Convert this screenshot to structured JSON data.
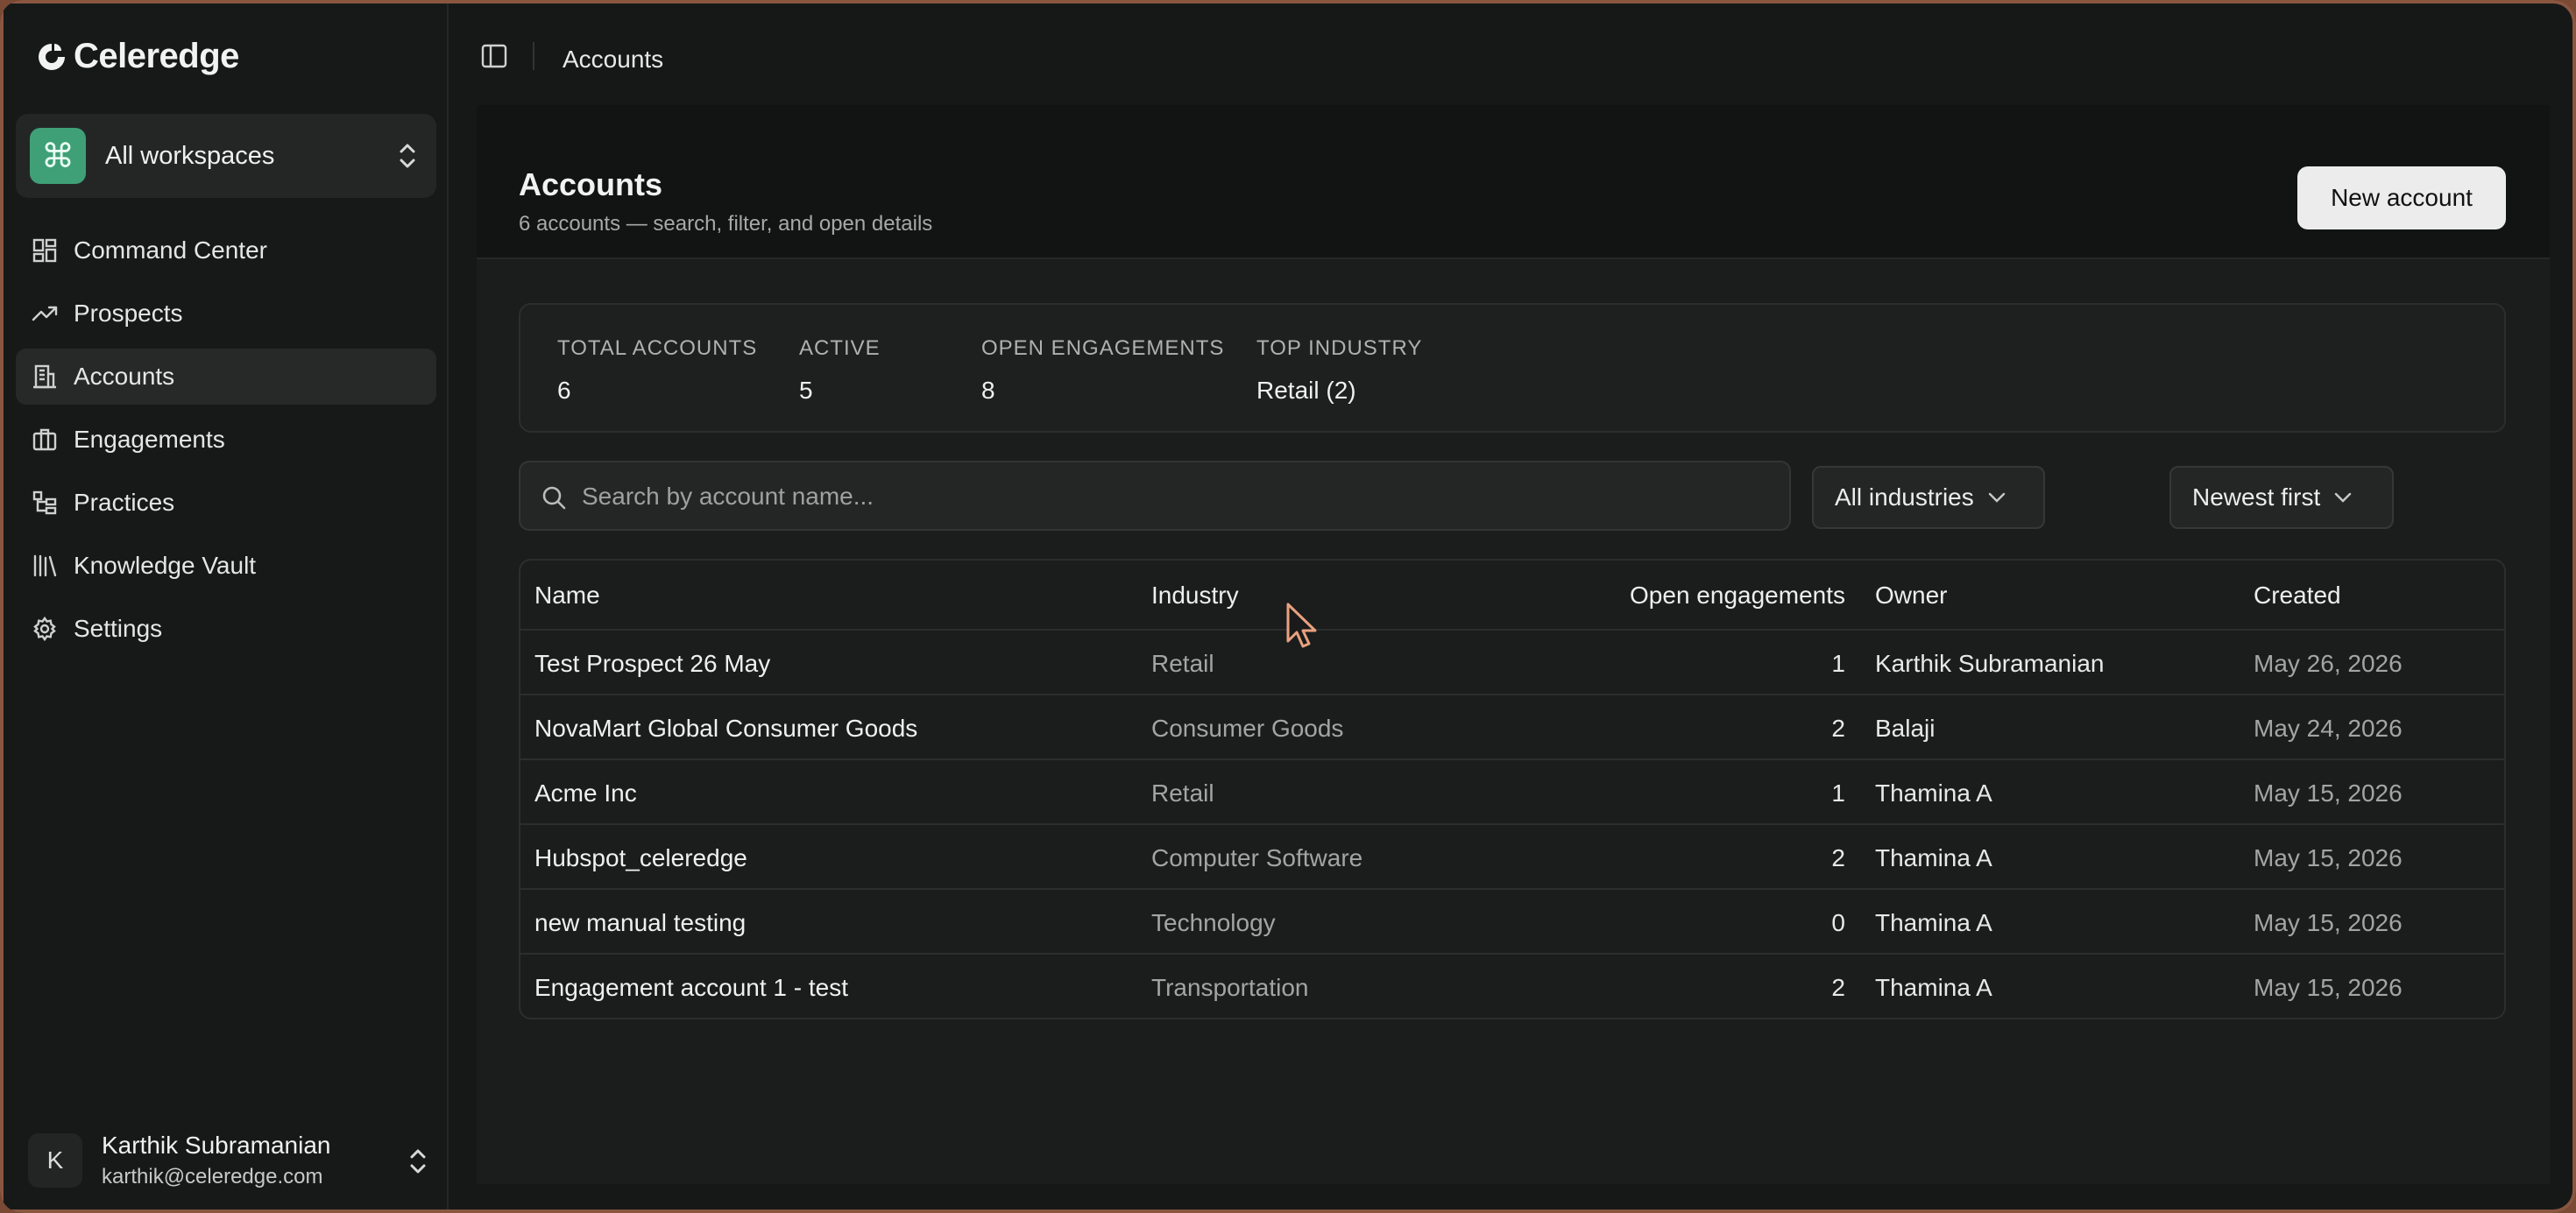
{
  "app": {
    "brand": "Celeredge"
  },
  "workspace": {
    "label": "All workspaces",
    "badge_icon": "⌘",
    "badge_color": "#3fa077"
  },
  "nav": [
    {
      "label": "Command Center",
      "icon": "dashboard-icon",
      "active": false
    },
    {
      "label": "Prospects",
      "icon": "trending-up-icon",
      "active": false
    },
    {
      "label": "Accounts",
      "icon": "building-icon",
      "active": true
    },
    {
      "label": "Engagements",
      "icon": "briefcase-icon",
      "active": false
    },
    {
      "label": "Practices",
      "icon": "hierarchy-icon",
      "active": false
    },
    {
      "label": "Knowledge Vault",
      "icon": "library-icon",
      "active": false
    },
    {
      "label": "Settings",
      "icon": "gear-icon",
      "active": false
    }
  ],
  "user": {
    "initial": "K",
    "name": "Karthik Subramanian",
    "email": "karthik@celeredge.com"
  },
  "topbar": {
    "title": "Accounts"
  },
  "page": {
    "title": "Accounts",
    "subtitle": "6 accounts — search, filter, and open details",
    "new_button": "New account"
  },
  "stats": [
    {
      "label": "TOTAL ACCOUNTS",
      "value": "6"
    },
    {
      "label": "ACTIVE",
      "value": "5"
    },
    {
      "label": "OPEN ENGAGEMENTS",
      "value": "8"
    },
    {
      "label": "TOP INDUSTRY",
      "value": "Retail (2)"
    }
  ],
  "search": {
    "placeholder": "Search by account name...",
    "value": ""
  },
  "filters": {
    "industry": "All industries",
    "sort": "Newest first"
  },
  "table": {
    "columns": [
      "Name",
      "Industry",
      "Open engagements",
      "Owner",
      "Created"
    ],
    "rows": [
      {
        "name": "Test Prospect 26 May",
        "industry": "Retail",
        "open": "1",
        "owner": "Karthik Subramanian",
        "created": "May 26, 2026"
      },
      {
        "name": "NovaMart Global Consumer Goods",
        "industry": "Consumer Goods",
        "open": "2",
        "owner": "Balaji",
        "created": "May 24, 2026"
      },
      {
        "name": "Acme Inc",
        "industry": "Retail",
        "open": "1",
        "owner": "Thamina A",
        "created": "May 15, 2026"
      },
      {
        "name": "Hubspot_celeredge",
        "industry": "Computer Software",
        "open": "2",
        "owner": "Thamina A",
        "created": "May 15, 2026"
      },
      {
        "name": "new manual testing",
        "industry": "Technology",
        "open": "0",
        "owner": "Thamina A",
        "created": "May 15, 2026"
      },
      {
        "name": "Engagement account 1 - test",
        "industry": "Transportation",
        "open": "2",
        "owner": "Thamina A",
        "created": "May 15, 2026"
      }
    ]
  }
}
